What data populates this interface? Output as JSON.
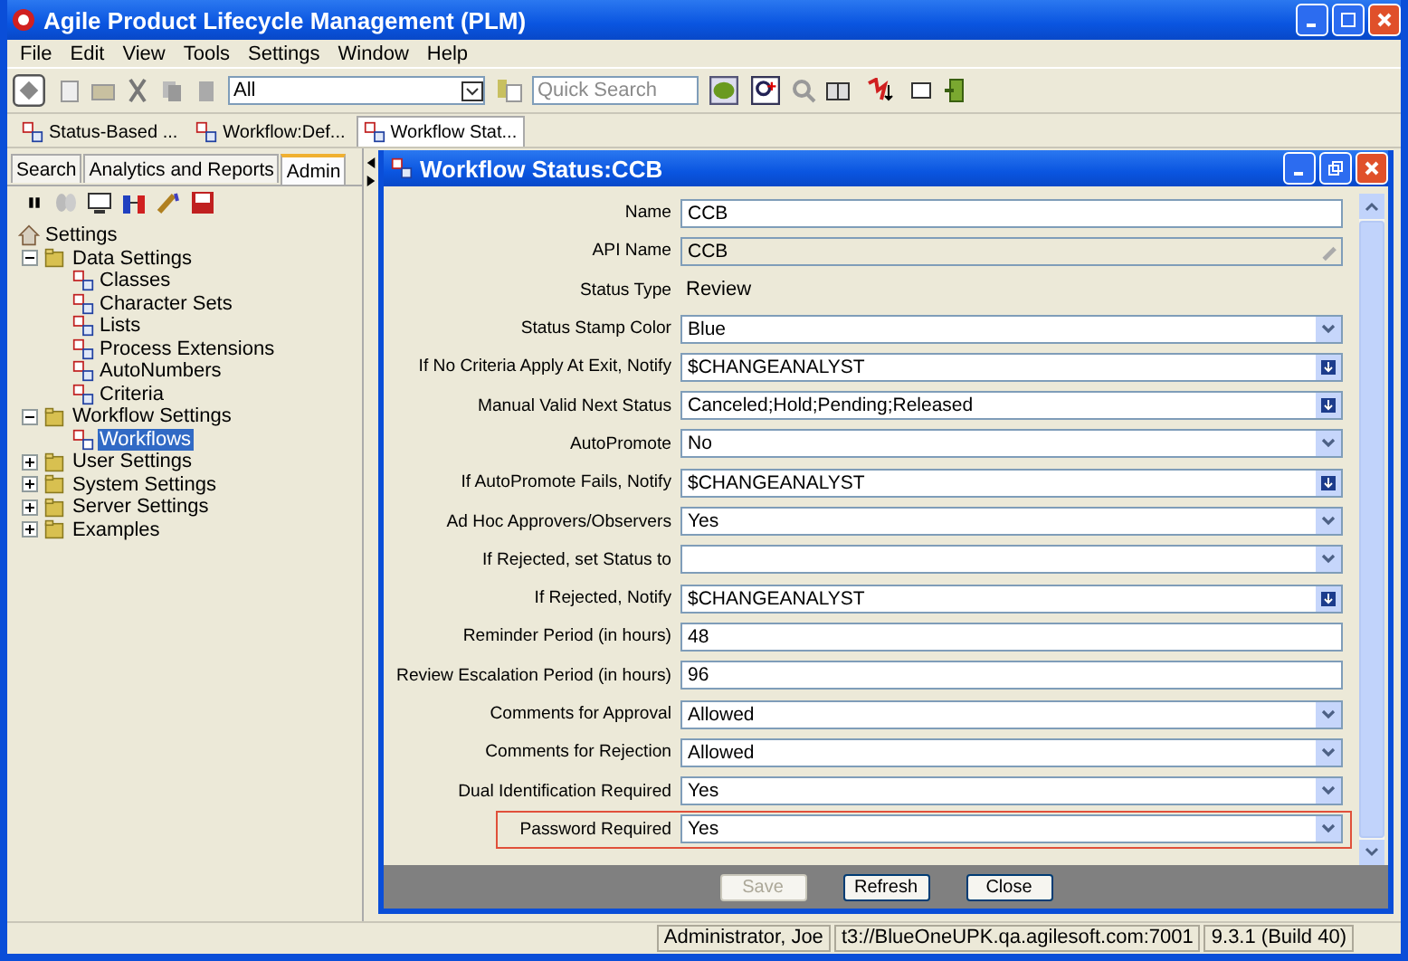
{
  "window": {
    "title": "Agile Product Lifecycle Management (PLM)"
  },
  "menu": [
    "File",
    "Edit",
    "View",
    "Tools",
    "Settings",
    "Window",
    "Help"
  ],
  "toolbar": {
    "scope": "All",
    "search": {
      "placeholder": "Quick Search"
    }
  },
  "doc_tabs": [
    {
      "label": "Status-Based ...",
      "selected": false
    },
    {
      "label": "Workflow:Def...",
      "selected": false
    },
    {
      "label": "Workflow Stat...",
      "selected": true
    }
  ],
  "left_tabs": [
    {
      "label": "Search",
      "selected": false
    },
    {
      "label": "Analytics and Reports",
      "selected": false
    },
    {
      "label": "Admin",
      "selected": true
    }
  ],
  "tree": [
    {
      "label": "Settings",
      "kind": "home",
      "selected": false,
      "children": [
        {
          "label": "Data Settings",
          "kind": "folder",
          "expanded": true,
          "selected": false,
          "children": [
            {
              "label": "Classes",
              "kind": "item",
              "selected": false
            },
            {
              "label": "Character Sets",
              "kind": "item",
              "selected": false
            },
            {
              "label": "Lists",
              "kind": "item",
              "selected": false
            },
            {
              "label": "Process Extensions",
              "kind": "item",
              "selected": false
            },
            {
              "label": "AutoNumbers",
              "kind": "item",
              "selected": false
            },
            {
              "label": "Criteria",
              "kind": "item",
              "selected": false
            }
          ]
        },
        {
          "label": "Workflow Settings",
          "kind": "folder",
          "expanded": true,
          "selected": false,
          "children": [
            {
              "label": "Workflows",
              "kind": "item",
              "selected": true
            }
          ]
        },
        {
          "label": "User Settings",
          "kind": "folder",
          "expanded": false,
          "selected": false
        },
        {
          "label": "System Settings",
          "kind": "folder",
          "expanded": false,
          "selected": false
        },
        {
          "label": "Server Settings",
          "kind": "folder",
          "expanded": false,
          "selected": false
        },
        {
          "label": "Examples",
          "kind": "folder",
          "expanded": false,
          "selected": false
        }
      ]
    }
  ],
  "inner_window": {
    "title": "Workflow Status:CCB"
  },
  "fields": [
    {
      "label": "Name",
      "kind": "text",
      "value": "CCB",
      "highlighted": false
    },
    {
      "label": "API Name",
      "kind": "readonly",
      "value": "CCB",
      "highlighted": false
    },
    {
      "label": "Status Type",
      "kind": "static",
      "value": "Review",
      "highlighted": false
    },
    {
      "label": "Status Stamp Color",
      "kind": "select",
      "value": "Blue",
      "highlighted": false
    },
    {
      "label": "If No Criteria Apply At Exit, Notify",
      "kind": "picker",
      "value": "$CHANGEANALYST",
      "highlighted": false
    },
    {
      "label": "Manual Valid Next Status",
      "kind": "picker",
      "value": "Canceled;Hold;Pending;Released",
      "highlighted": false
    },
    {
      "label": "AutoPromote",
      "kind": "select",
      "value": "No",
      "highlighted": false
    },
    {
      "label": "If AutoPromote Fails, Notify",
      "kind": "picker",
      "value": "$CHANGEANALYST",
      "highlighted": false
    },
    {
      "label": "Ad Hoc Approvers/Observers",
      "kind": "select",
      "value": "Yes",
      "highlighted": false
    },
    {
      "label": "If Rejected, set Status to",
      "kind": "select",
      "highlighted": false
    },
    {
      "label": "If Rejected, Notify",
      "kind": "picker",
      "value": "$CHANGEANALYST",
      "highlighted": false
    },
    {
      "label": "Reminder Period (in hours)",
      "kind": "text",
      "value": "48",
      "highlighted": false
    },
    {
      "label": "Review Escalation Period (in hours)",
      "kind": "text",
      "value": "96",
      "highlighted": false
    },
    {
      "label": "Comments for Approval",
      "kind": "select",
      "value": "Allowed",
      "highlighted": false
    },
    {
      "label": "Comments for Rejection",
      "kind": "select",
      "value": "Allowed",
      "highlighted": false
    },
    {
      "label": "Dual Identification Required",
      "kind": "select",
      "value": "Yes",
      "highlighted": false
    },
    {
      "label": "Password Required",
      "kind": "select",
      "value": "Yes",
      "highlighted": true
    }
  ],
  "buttons": [
    {
      "label": "Save",
      "disabled": true
    },
    {
      "label": "Refresh",
      "disabled": false
    },
    {
      "label": "Close",
      "disabled": false
    }
  ],
  "status_bar": [
    "Administrator, Joe",
    "t3://BlueOneUPK.qa.agilesoft.com:7001",
    "9.3.1 (Build 40)"
  ]
}
